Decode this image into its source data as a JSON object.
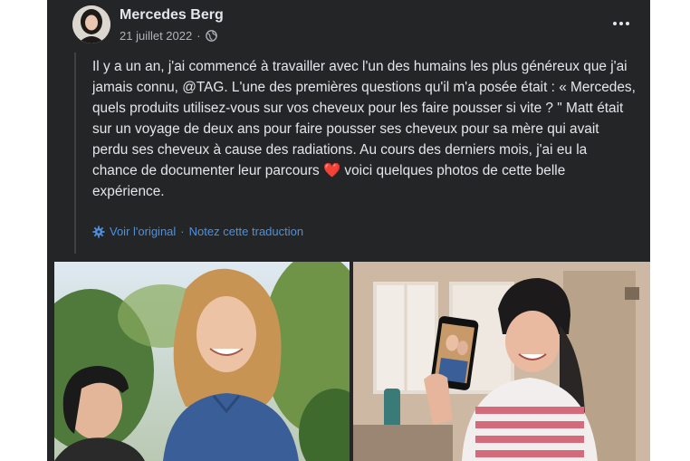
{
  "post": {
    "author": "Mercedes Berg",
    "date": "21 juillet 2022",
    "separator": "·",
    "body_before_heart": "Il y a un an, j'ai commencé à travailler avec l'un des humains les plus généreux que j'ai jamais connu, @TAG. L'une des premières questions qu'il m'a posée était : « Mercedes, quels produits utilisez-vous sur vos cheveux pour les faire pousser si vite ? \" Matt était sur un voyage de deux ans pour faire pousser ses cheveux pour sa mère qui avait perdu ses cheveux à cause des radiations. Au cours des derniers mois, j'ai eu la chance de documenter leur parcours",
    "heart": "❤️",
    "body_after_heart": " voici quelques photos de cette belle expérience.",
    "see_original": "Voir l'original",
    "rate_translation": "Notez cette traduction",
    "link_separator": "·"
  },
  "icons": {
    "privacy": "globe-icon",
    "translation": "gear-icon",
    "menu": "more-options-icon"
  },
  "colors": {
    "background": "#242526",
    "text": "#e4e6eb",
    "secondary_text": "#b0b3b8",
    "link": "#4e90e0",
    "heart": "#f02849"
  }
}
